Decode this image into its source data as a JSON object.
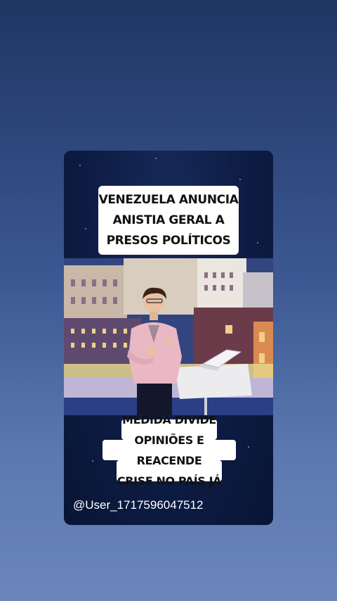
{
  "post": {
    "headline": "VENEZUELA ANUNCIA\nANISTIA GERAL A\nPRESOS POLÍTICOS",
    "subheadline": "MEDIDA DIVIDE\nOPINIÕES E REACENDE\nCRISE NO PAÍS JÁ",
    "username": "@User_1717596047512"
  },
  "colors": {
    "background": "#3b5792",
    "card": "#0d1c44",
    "caption_box": "#ffffff",
    "caption_text": "#111111",
    "presenter_jacket": "#e9b8c4"
  },
  "media": {
    "scene": "news-presenter-in-front-of-city-at-night",
    "laptop_icon": "laptop-icon"
  }
}
